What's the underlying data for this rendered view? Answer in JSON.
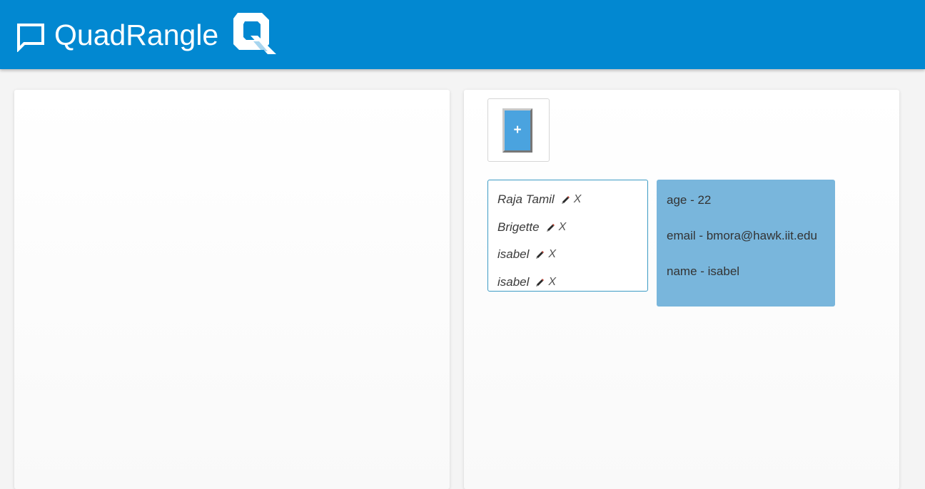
{
  "header": {
    "title": "QuadRangle",
    "icons": [
      "chat-bubble-icon",
      "quadrangle-q-logo"
    ],
    "color": "#0288d1"
  },
  "add_button": {
    "label": "+"
  },
  "users": [
    {
      "name": "Raja Tamil",
      "delete_label": "X"
    },
    {
      "name": "Brigette",
      "delete_label": "X"
    },
    {
      "name": "isabel",
      "delete_label": "X"
    },
    {
      "name": "isabel",
      "delete_label": "X"
    }
  ],
  "details": {
    "age": "age - 22",
    "email": "email - bmora@hawk.iit.edu",
    "name": "name - isabel"
  },
  "colors": {
    "card_bg": "#79b6dc",
    "button_bg": "#4aa3df",
    "list_border": "#3d9bc4"
  }
}
